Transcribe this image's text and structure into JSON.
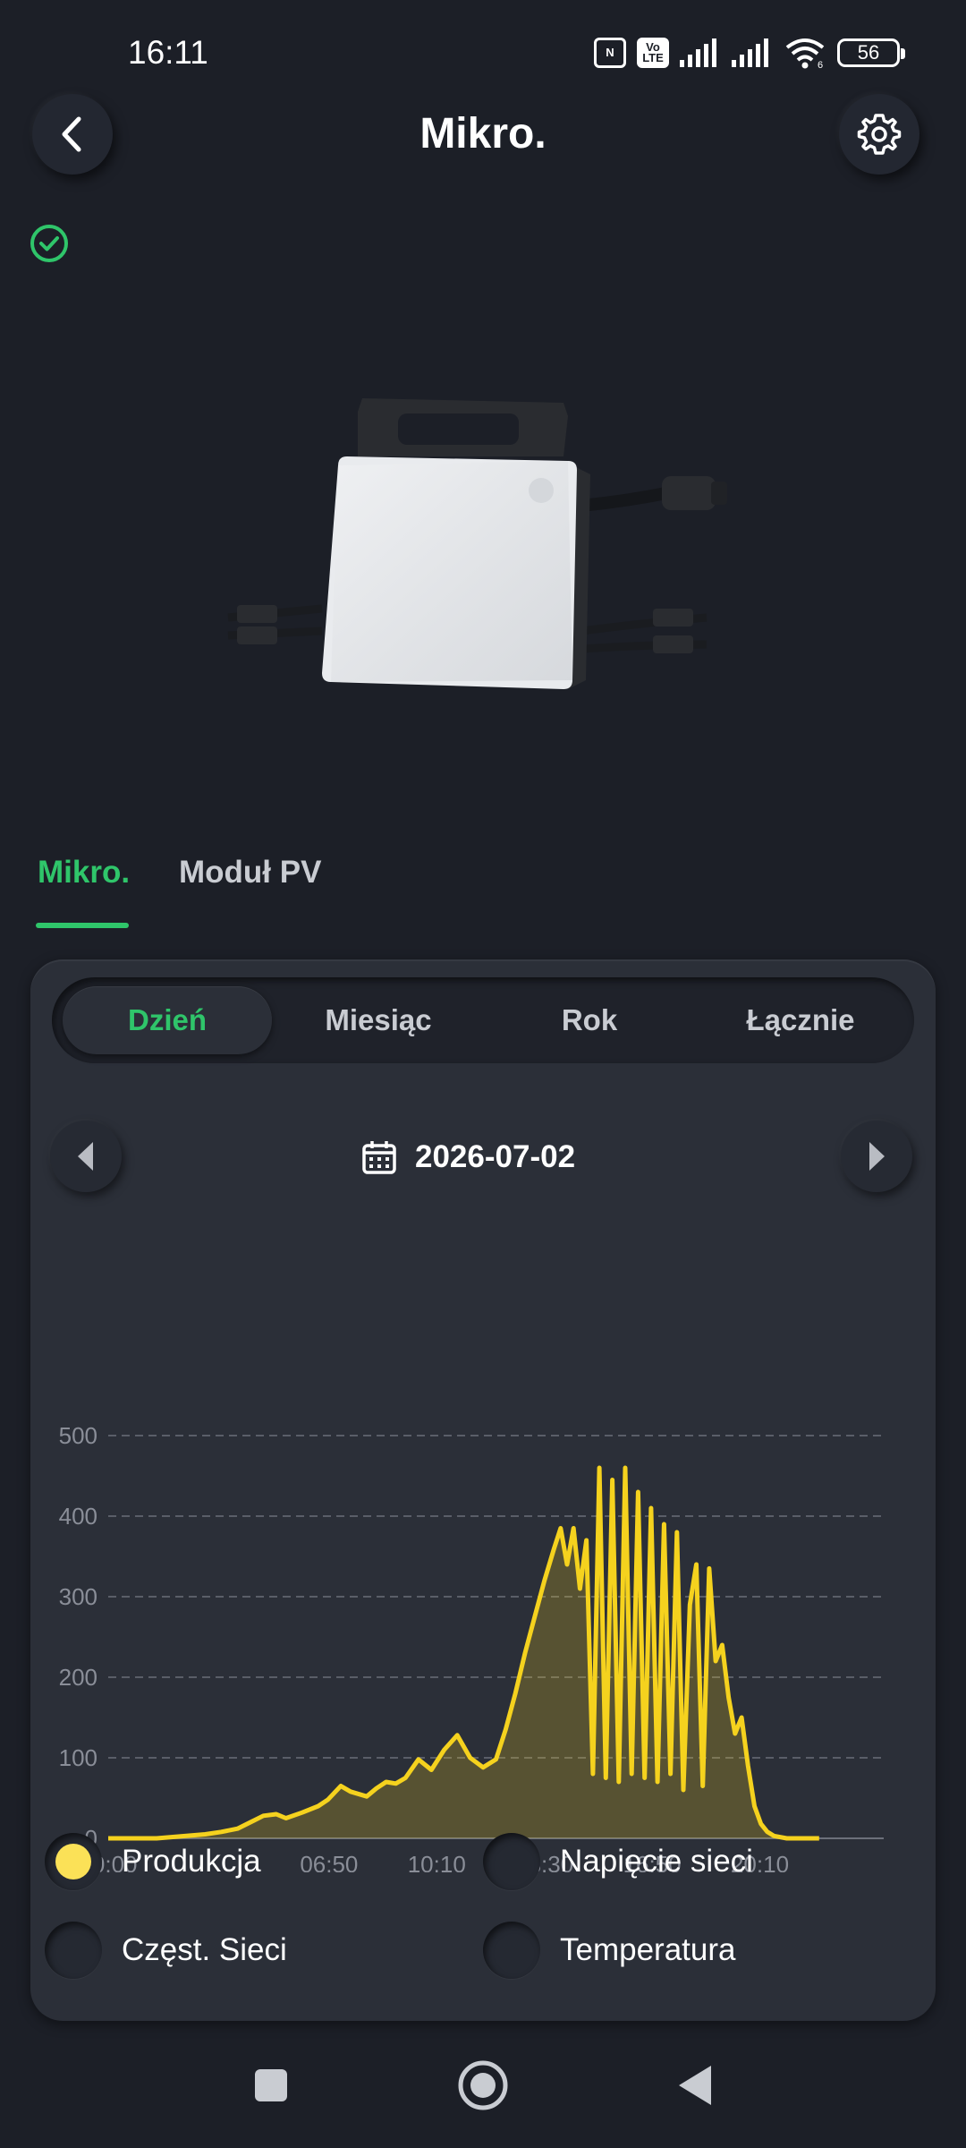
{
  "status_bar": {
    "time": "16:11",
    "battery": "56",
    "volte_label": "Vo LTE",
    "wifi_label": "6"
  },
  "header": {
    "title": "Mikro."
  },
  "tabs": [
    {
      "label": "Mikro.",
      "active": true
    },
    {
      "label": "Moduł PV",
      "active": false
    }
  ],
  "period": {
    "options": [
      "Dzień",
      "Miesiąc",
      "Rok",
      "Łącznie"
    ],
    "selected": "Dzień"
  },
  "date": "2026-07-02",
  "chart_data": {
    "type": "area",
    "x_ticks": [
      "00:00",
      "06:50",
      "10:10",
      "13:30",
      "16:50",
      "20:10"
    ],
    "y_ticks": [
      "500",
      "400",
      "300",
      "200",
      "100",
      "0"
    ],
    "ylim": [
      0,
      500
    ],
    "xlim_hours": [
      0,
      24
    ],
    "grid": "dashed horizontal",
    "color": "#f5d21e",
    "series": [
      {
        "x": [
          0,
          1.5,
          3.0,
          3.5,
          4.0,
          4.5,
          4.8,
          5.2,
          5.5,
          6.0,
          6.5,
          6.8,
          7.2,
          7.5,
          8.0,
          8.3,
          8.6,
          8.9,
          9.2,
          9.6,
          10.0,
          10.4,
          10.8,
          11.2,
          11.6,
          12.0,
          12.3,
          12.6,
          12.9,
          13.2,
          13.5,
          13.8,
          14.0,
          14.2,
          14.4,
          14.6,
          14.8,
          15.0,
          15.2,
          15.4,
          15.6,
          15.8,
          16.0,
          16.2,
          16.4,
          16.6,
          16.8,
          17.0,
          17.2,
          17.4,
          17.6,
          17.8,
          18.0,
          18.2,
          18.4,
          18.6,
          18.8,
          19.0,
          19.2,
          19.4,
          19.6,
          19.8,
          20.0,
          20.2,
          20.4,
          20.6,
          21.0,
          21.5,
          22.0
        ],
        "y": [
          0,
          0,
          5,
          8,
          12,
          22,
          28,
          30,
          25,
          32,
          40,
          48,
          65,
          58,
          52,
          62,
          70,
          68,
          75,
          98,
          85,
          110,
          128,
          100,
          88,
          98,
          135,
          180,
          230,
          275,
          320,
          360,
          385,
          340,
          385,
          310,
          370,
          80,
          460,
          75,
          445,
          70,
          460,
          80,
          430,
          75,
          410,
          70,
          390,
          80,
          380,
          60,
          290,
          340,
          65,
          335,
          220,
          240,
          175,
          130,
          150,
          90,
          40,
          18,
          8,
          3,
          0,
          0,
          0
        ]
      }
    ]
  },
  "legend": [
    {
      "label": "Produkcja",
      "active": true,
      "color": "#fbe157"
    },
    {
      "label": "Napięcie sieci",
      "active": false,
      "color": "#252932"
    },
    {
      "label": "Częst. Sieci",
      "active": false,
      "color": "#252932"
    },
    {
      "label": "Temperatura",
      "active": false,
      "color": "#252932"
    }
  ]
}
